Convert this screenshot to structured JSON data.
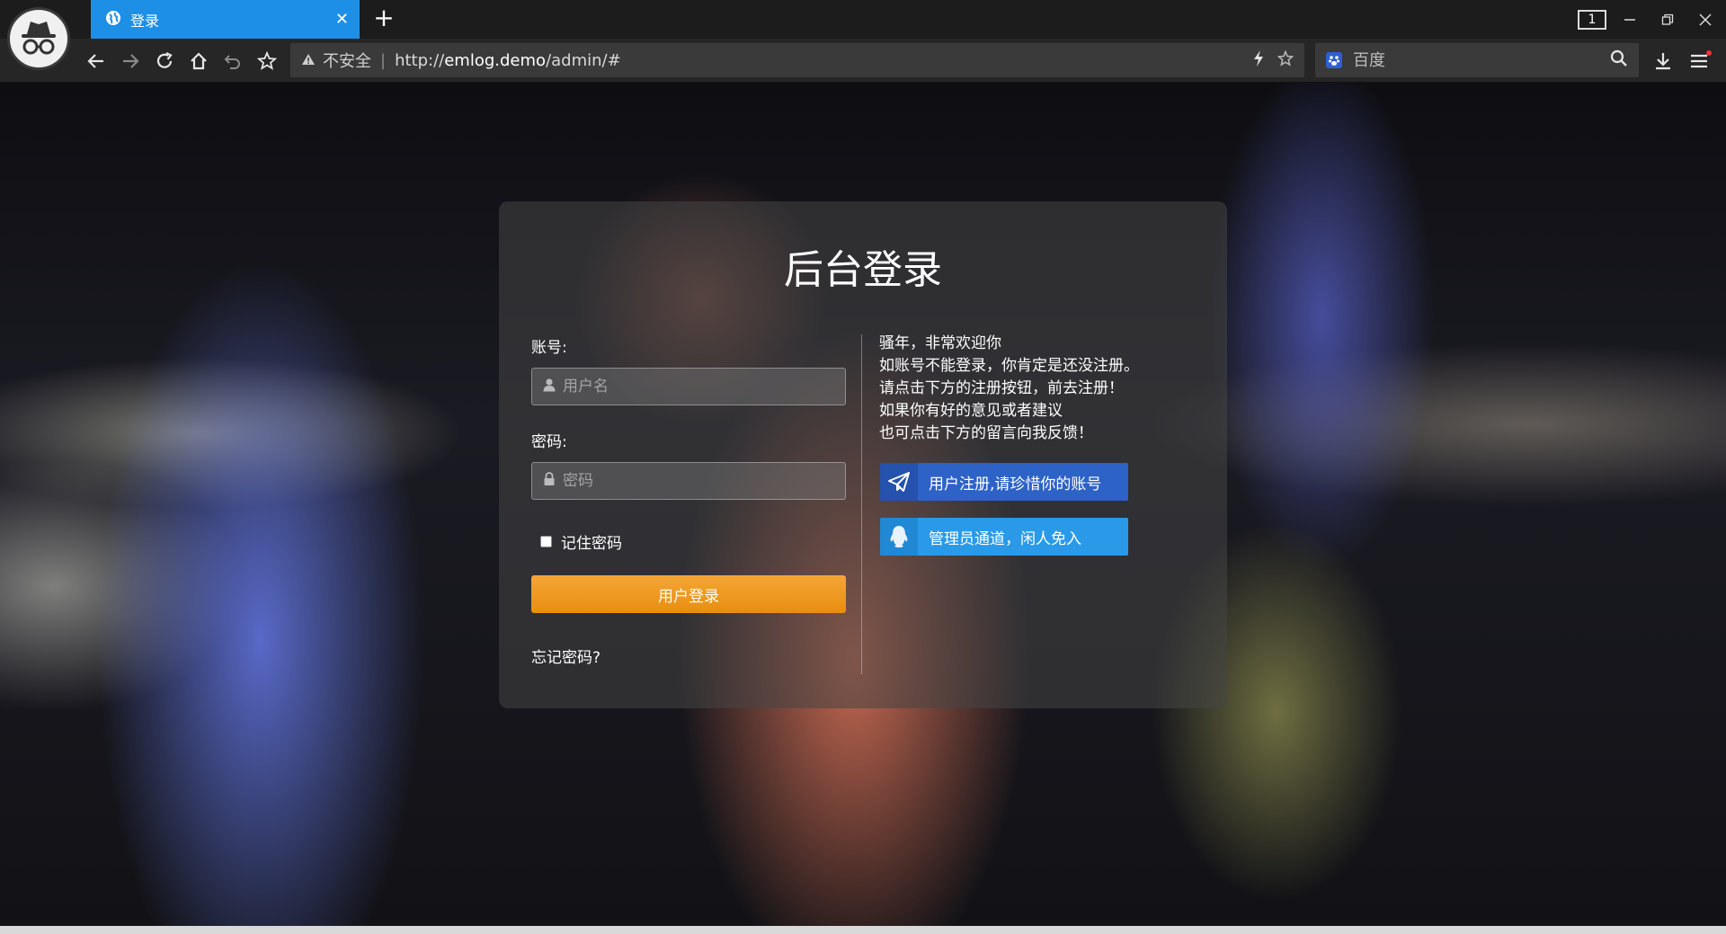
{
  "browser": {
    "tab_title": "登录",
    "tab_count": "1",
    "address": {
      "security_label": "不安全",
      "url_prefix": "http://",
      "url_host": "emlog.demo",
      "url_path": "/admin/#"
    },
    "search_engine": {
      "placeholder": "百度"
    }
  },
  "login": {
    "title": "后台登录",
    "username_label": "账号:",
    "username_placeholder": "用户名",
    "password_label": "密码:",
    "password_placeholder": "密码",
    "remember_label": "记住密码",
    "login_button": "用户登录",
    "forgot_link": "忘记密码?"
  },
  "welcome": {
    "lines": [
      "骚年，非常欢迎你",
      "如账号不能登录，你肯定是还没注册。",
      "请点击下方的注册按钮，前去注册！",
      "如果你有好的意见或者建议",
      "也可点击下方的留言向我反馈！"
    ],
    "register_button": "用户注册,请珍惜你的账号",
    "admin_button": "管理员通道，闲人免入"
  },
  "colors": {
    "tab_active": "#1e8fe6",
    "login_button": "#f09a22",
    "register_button": "#2d62c7",
    "admin_button": "#2a9ae8"
  },
  "icons": [
    "incognito-icon",
    "globe-icon",
    "close-icon",
    "plus-icon",
    "back-icon",
    "forward-icon",
    "reload-icon",
    "home-icon",
    "undo-icon",
    "star-icon",
    "warning-icon",
    "lightning-icon",
    "bookmark-star-icon",
    "baidu-icon",
    "search-icon",
    "download-icon",
    "menu-icon",
    "user-icon",
    "lock-icon",
    "paper-plane-icon",
    "qq-penguin-icon"
  ]
}
